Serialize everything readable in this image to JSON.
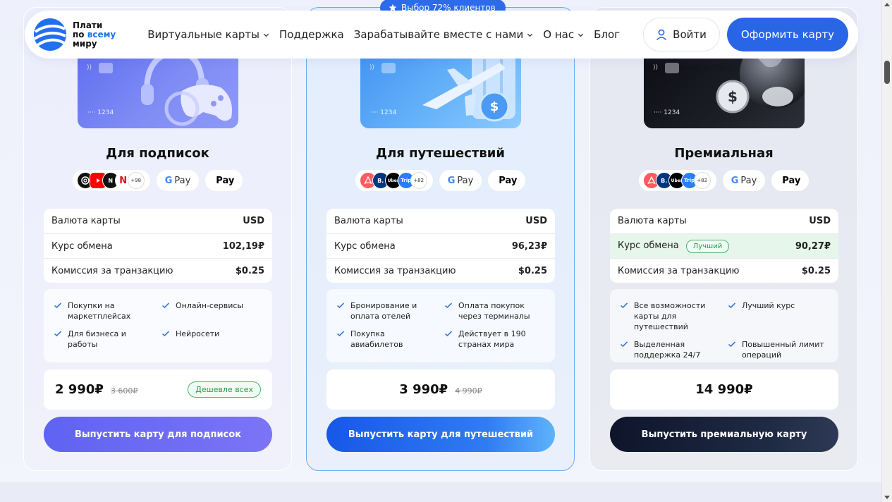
{
  "header": {
    "logo_line1": "Плати",
    "logo_line2a": "по",
    "logo_line2b": "всему",
    "logo_line3": "миру",
    "menu": [
      {
        "label": "Виртуальные карты",
        "dropdown": true
      },
      {
        "label": "Поддержка",
        "dropdown": false
      },
      {
        "label": "Зарабатывайте вместе с нами",
        "dropdown": true
      },
      {
        "label": "О нас",
        "dropdown": true
      },
      {
        "label": "Блог",
        "dropdown": false
      }
    ],
    "login_label": "Войти",
    "order_label": "Оформить карту"
  },
  "featured_badge": "Выбор 72% клиентов",
  "cards": [
    {
      "card_number": "···· 1234",
      "title": "Для подписок",
      "brands": [
        "openai",
        "youtube",
        "notion",
        "netflix"
      ],
      "brands_more": "+98",
      "pay_google": "Pay",
      "pay_apple": "Pay",
      "rates": [
        {
          "label": "Валюта карты",
          "value": "USD"
        },
        {
          "label": "Курс обмена",
          "value": "102,19₽"
        },
        {
          "label": "Комиссия за транзакцию",
          "value": "$0.25"
        }
      ],
      "features": [
        "Покупки на маркетплейсах",
        "Онлайн-сервисы",
        "Для бизнеса и работы",
        "Нейросети"
      ],
      "price": "2 990₽",
      "old_price": "3 600₽",
      "tag": "Дешевле всех",
      "button": "Выпустить карту для подписок"
    },
    {
      "card_number": "···· 1234",
      "title": "Для путешествий",
      "brands": [
        "airbnb",
        "booking",
        "uber",
        "trip"
      ],
      "brands_more": "+82",
      "pay_google": "Pay",
      "pay_apple": "Pay",
      "rates": [
        {
          "label": "Валюта карты",
          "value": "USD"
        },
        {
          "label": "Курс обмена",
          "value": "96,23₽"
        },
        {
          "label": "Комиссия за транзакцию",
          "value": "$0.25"
        }
      ],
      "features": [
        "Бронирование и оплата отелей",
        "Оплата покупок через терминалы",
        "Покупка авиабилетов",
        "Действует в 190 странах мира"
      ],
      "price": "3 990₽",
      "old_price": "4 990₽",
      "button": "Выпустить карту для путешествий"
    },
    {
      "card_number": "···· 1234",
      "title": "Премиальная",
      "brands": [
        "airbnb",
        "booking",
        "uber",
        "trip"
      ],
      "brands_more": "+82",
      "pay_google": "Pay",
      "pay_apple": "Pay",
      "rates": [
        {
          "label": "Валюта карты",
          "value": "USD"
        },
        {
          "label": "Курс обмена",
          "value": "90,27₽",
          "tag": "Лучший"
        },
        {
          "label": "Комиссия за транзакцию",
          "value": "$0.25"
        }
      ],
      "features": [
        "Все возможности карты для путешествий",
        "Лучший курс",
        "Выделенная поддержка 24/7",
        "Повышенный лимит операций"
      ],
      "price": "14 990₽",
      "button": "Выпустить премиальную карту"
    }
  ],
  "brand_text": {
    "uber": "Uber",
    "trip": "Trip",
    "booking": "B.",
    "notion": "N",
    "netflix": "N"
  },
  "colors": {
    "accent": "#2866e6",
    "success": "#2a9a4a"
  }
}
